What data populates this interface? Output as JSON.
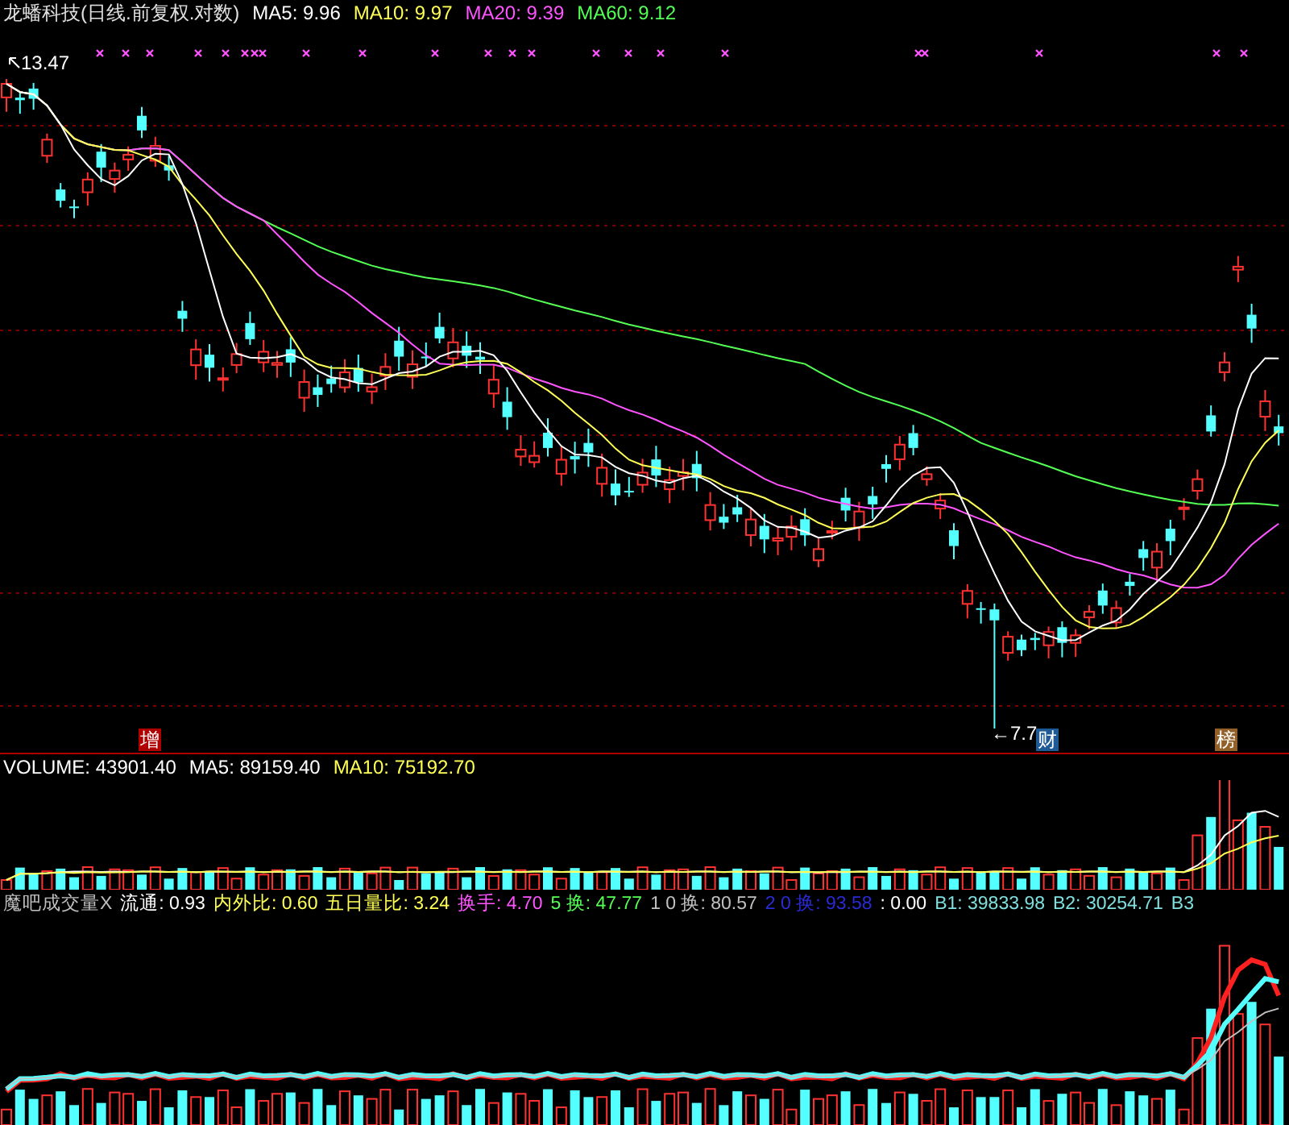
{
  "title": {
    "name": "龙蟠科技(日线.前复权.对数)",
    "ma": [
      {
        "label": "MA5: 9.96",
        "color": "#ffffff"
      },
      {
        "label": "MA10: 9.97",
        "color": "#ffff54"
      },
      {
        "label": "MA20: 9.39",
        "color": "#ff54ff"
      },
      {
        "label": "MA60: 9.12",
        "color": "#54ff54"
      }
    ]
  },
  "price_panel": {
    "high_label": "13.47",
    "low_label": "←7.7",
    "badges": [
      {
        "text": "增",
        "color": "#b00000"
      },
      {
        "text": "财",
        "color": "#1e5a96"
      },
      {
        "text": "榜",
        "color": "#94602a"
      }
    ]
  },
  "volume_panel": {
    "legend": [
      {
        "label": "VOLUME: 43901.40",
        "color": "#ffffff"
      },
      {
        "label": "MA5: 89159.40",
        "color": "#ffffff"
      },
      {
        "label": "MA10: 75192.70",
        "color": "#ffff54"
      }
    ]
  },
  "indicator_panel": {
    "legend": [
      {
        "label": "魔吧成交量X",
        "color": "#c0c0c0"
      },
      {
        "label": "流通: 0.93",
        "color": "#ffffff"
      },
      {
        "label": "内外比: 0.60",
        "color": "#ffff54"
      },
      {
        "label": "五日量比: 3.24",
        "color": "#ffff54"
      },
      {
        "label": "换手: 4.70",
        "color": "#ff54ff"
      },
      {
        "label": "5 换: 47.77",
        "color": "#54ff54"
      },
      {
        "label": "1 0 换: 80.57",
        "color": "#c0c0c0"
      },
      {
        "label": "2 0 换: 93.58",
        "color": "#2a2ad8"
      },
      {
        "label": ": 0.00",
        "color": "#ffffff"
      },
      {
        "label": "B1: 39833.98",
        "color": "#7fe0e0"
      },
      {
        "label": "B2: 30254.71",
        "color": "#7fe0e0"
      },
      {
        "label": "B3",
        "color": "#7fe0e0"
      }
    ]
  }
}
